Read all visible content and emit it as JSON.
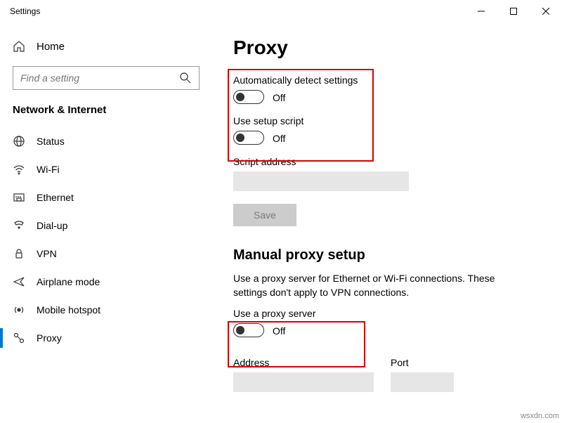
{
  "window": {
    "title": "Settings"
  },
  "sidebar": {
    "home_label": "Home",
    "search_placeholder": "Find a setting",
    "category": "Network & Internet",
    "items": [
      {
        "label": "Status"
      },
      {
        "label": "Wi-Fi"
      },
      {
        "label": "Ethernet"
      },
      {
        "label": "Dial-up"
      },
      {
        "label": "VPN"
      },
      {
        "label": "Airplane mode"
      },
      {
        "label": "Mobile hotspot"
      },
      {
        "label": "Proxy"
      }
    ]
  },
  "main": {
    "title": "Proxy",
    "auto_detect_label": "Automatically detect settings",
    "auto_detect_state": "Off",
    "setup_script_label": "Use setup script",
    "setup_script_state": "Off",
    "script_address_label": "Script address",
    "save_label": "Save",
    "manual_heading": "Manual proxy setup",
    "manual_desc": "Use a proxy server for Ethernet or Wi-Fi connections. These settings don't apply to VPN connections.",
    "use_proxy_label": "Use a proxy server",
    "use_proxy_state": "Off",
    "address_label": "Address",
    "port_label": "Port"
  },
  "watermark": "wsxdn.com"
}
